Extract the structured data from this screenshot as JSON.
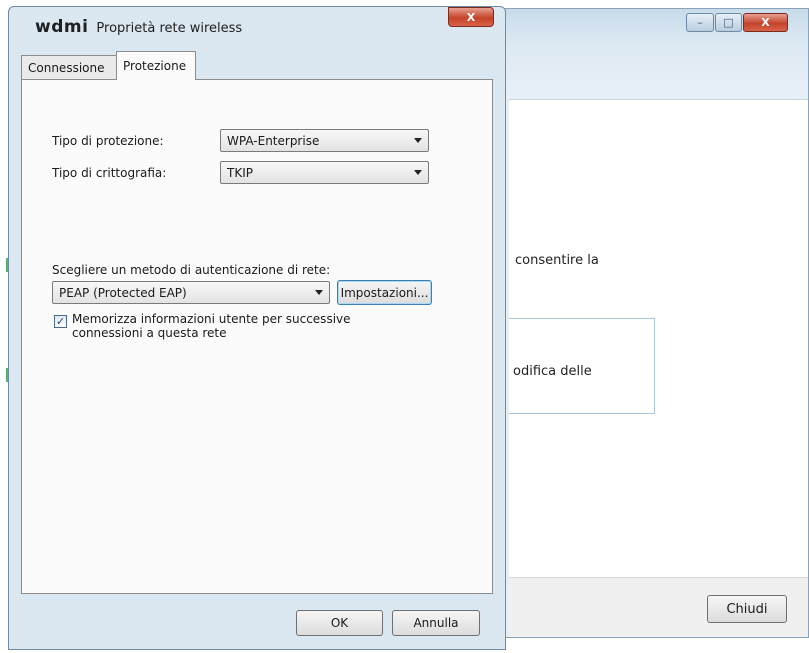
{
  "background_window": {
    "text_line1": "consentire la",
    "text_line2": "odifica delle",
    "close_button": "Chiudi",
    "caption_min": "–",
    "caption_max": "□",
    "caption_close": "X"
  },
  "dialog": {
    "app_name": "wdmi",
    "title": "Proprietà rete wireless",
    "caption_close": "X",
    "tabs": [
      {
        "label": "Connessione"
      },
      {
        "label": "Protezione"
      }
    ],
    "security_type": {
      "label": "Tipo di protezione:",
      "value": "WPA-Enterprise"
    },
    "encryption_type": {
      "label": "Tipo di crittografia:",
      "value": "TKIP"
    },
    "auth_method": {
      "label": "Scegliere un metodo di autenticazione di rete:",
      "value": "PEAP (Protected EAP)",
      "settings_button": "Impostazioni..."
    },
    "remember_credentials": {
      "checked": true,
      "check_glyph": "✓",
      "line1": "Memorizza informazioni utente per successive",
      "line2": "connessioni a questa rete"
    },
    "ok_button": "OK",
    "cancel_button": "Annulla"
  }
}
